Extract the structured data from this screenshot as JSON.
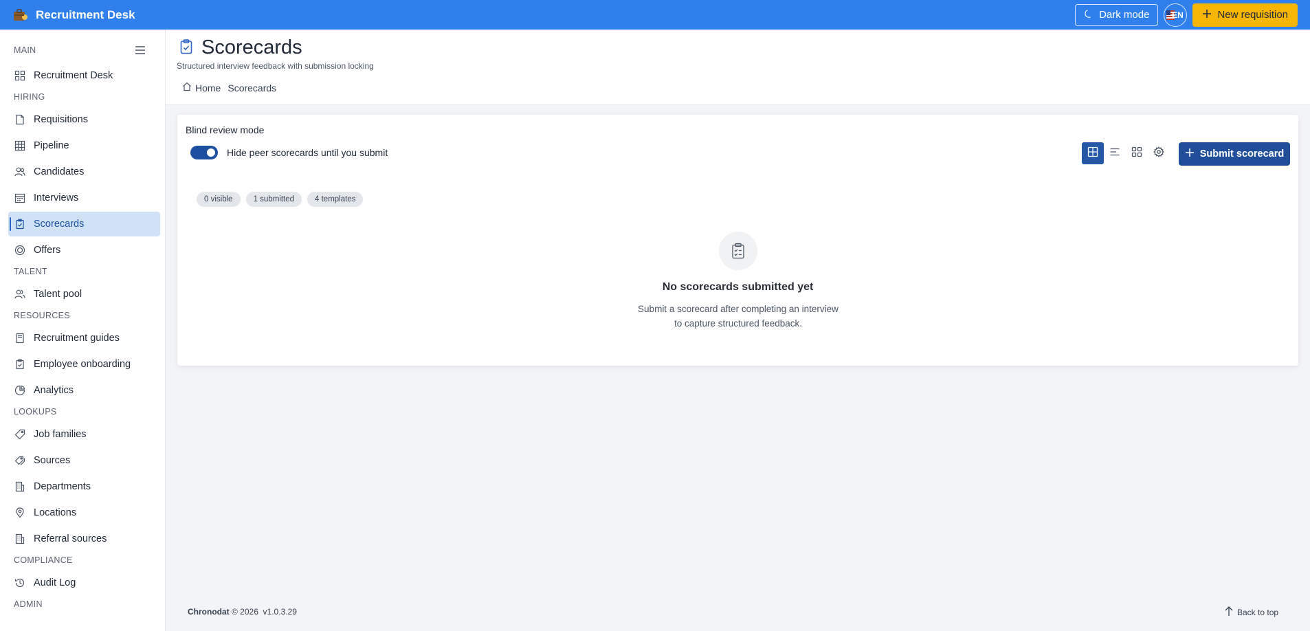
{
  "app": {
    "title": "Recruitment Desk"
  },
  "topbar": {
    "dark_mode_label": "Dark mode",
    "lang_label": "EN",
    "new_requisition_label": "New requisition"
  },
  "sidebar": {
    "sections": [
      {
        "label": "MAIN",
        "items": [
          {
            "label": "Recruitment Desk",
            "icon": "grid-icon"
          }
        ]
      },
      {
        "label": "HIRING",
        "items": [
          {
            "label": "Requisitions",
            "icon": "file-icon"
          },
          {
            "label": "Pipeline",
            "icon": "table-icon"
          },
          {
            "label": "Candidates",
            "icon": "users-icon"
          },
          {
            "label": "Interviews",
            "icon": "calendar-icon"
          },
          {
            "label": "Scorecards",
            "icon": "clipboard-check-icon",
            "active": true
          },
          {
            "label": "Offers",
            "icon": "target-icon"
          }
        ]
      },
      {
        "label": "TALENT",
        "items": [
          {
            "label": "Talent pool",
            "icon": "user-group-icon"
          }
        ]
      },
      {
        "label": "RESOURCES",
        "items": [
          {
            "label": "Recruitment guides",
            "icon": "book-icon"
          },
          {
            "label": "Employee onboarding",
            "icon": "clipboard-icon"
          },
          {
            "label": "Analytics",
            "icon": "chart-icon"
          }
        ]
      },
      {
        "label": "LOOKUPS",
        "items": [
          {
            "label": "Job families",
            "icon": "tag-icon"
          },
          {
            "label": "Sources",
            "icon": "tags-icon"
          },
          {
            "label": "Departments",
            "icon": "building-icon"
          },
          {
            "label": "Locations",
            "icon": "map-pin-icon"
          },
          {
            "label": "Referral sources",
            "icon": "building-icon"
          }
        ]
      },
      {
        "label": "COMPLIANCE",
        "items": [
          {
            "label": "Audit Log",
            "icon": "history-icon"
          }
        ]
      },
      {
        "label": "ADMIN",
        "items": []
      }
    ]
  },
  "header": {
    "title": "Scorecards",
    "subtitle": "Structured interview feedback with submission locking",
    "breadcrumb": {
      "home": "Home",
      "current": "Scorecards"
    }
  },
  "card": {
    "blind_label": "Blind review mode",
    "toggle_label": "Hide peer scorecards until you submit",
    "toggle_on": true,
    "submit_label": "Submit scorecard",
    "chips": [
      "0 visible",
      "1 submitted",
      "4 templates"
    ],
    "empty_title": "No scorecards submitted yet",
    "empty_desc": "Submit a scorecard after completing an interview to capture structured feedback."
  },
  "footer": {
    "brand": "Chronodat",
    "copyright": "© 2026",
    "version": "v1.0.3.29",
    "back_to_top": "Back to top"
  },
  "colors": {
    "topbar": "#2f80ed",
    "accent": "#f6b500",
    "primary": "#204e98",
    "active_bg": "#cfe2f6"
  }
}
